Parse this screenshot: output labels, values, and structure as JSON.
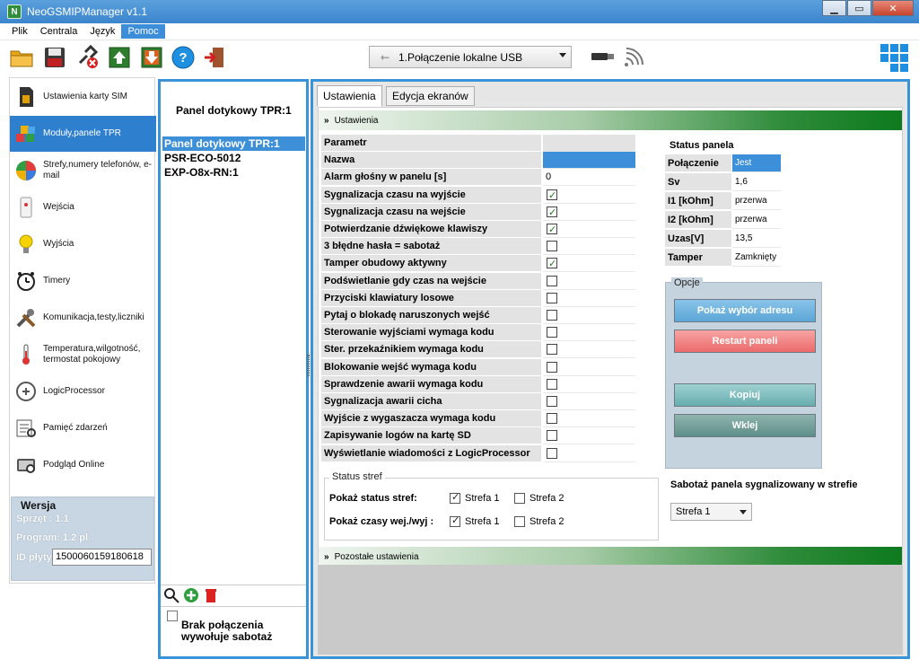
{
  "window": {
    "title": "NeoGSMIPManager v1.1",
    "icon_letter": "N",
    "minimize": "▁",
    "maximize": "▭",
    "close": "✕"
  },
  "menu": [
    "Plik",
    "Centrala",
    "Język",
    "Pomoc"
  ],
  "toolbar": {
    "icons": [
      "open-folder-icon",
      "save-disk-icon",
      "disconnect-icon",
      "upload-chip-icon",
      "download-chip-icon",
      "help-icon",
      "exit-icon"
    ],
    "connection": "1.Połączenie lokalne USB",
    "help_glyph": "?"
  },
  "nav": [
    {
      "label": "Ustawienia karty SIM",
      "icon": "sim-card-icon"
    },
    {
      "label": "Moduły,panele TPR",
      "icon": "modules-blocks-icon"
    },
    {
      "label": "Strefy,numery telefonów, e-mail",
      "icon": "zones-pie-icon"
    },
    {
      "label": "Wejścia",
      "icon": "inputs-sensor-icon"
    },
    {
      "label": "Wyjścia",
      "icon": "outputs-bulb-icon"
    },
    {
      "label": "Timery",
      "icon": "timer-clock-icon"
    },
    {
      "label": "Komunikacja,testy,liczniki",
      "icon": "tools-icon"
    },
    {
      "label": "Temperatura,wilgotność, termostat pokojowy",
      "icon": "thermometer-icon"
    },
    {
      "label": "LogicProcessor",
      "icon": "logic-processor-icon"
    },
    {
      "label": "Pamięć zdarzeń",
      "icon": "event-memory-icon"
    },
    {
      "label": "Podgląd Online",
      "icon": "online-preview-icon"
    }
  ],
  "version": {
    "title": "Wersja",
    "hw": "Sprzęt : 1.1",
    "program": "Program: 1.2 pl",
    "board_label": "ID płyty",
    "board_id": "1500060159180618"
  },
  "devices": {
    "title": "Panel dotykowy TPR:1",
    "items": [
      "Panel dotykowy TPR:1",
      "PSR-ECO-5012",
      "EXP-O8x-RN:1"
    ],
    "footer": "Brak połączenia wywołuje sabotaż"
  },
  "tabs": [
    "Ustawienia",
    "Edycja ekranów"
  ],
  "section1": "Ustawienia",
  "section2": "Pozostałe ustawienia",
  "params": {
    "header": "Parametr",
    "rows": [
      {
        "label": "Nazwa",
        "value": "",
        "type": "text"
      },
      {
        "label": "Alarm głośny w panelu [s]",
        "value": "0",
        "type": "text"
      },
      {
        "label": "Sygnalizacja czasu na wyjście",
        "checked": true,
        "type": "check"
      },
      {
        "label": "Sygnalizacja czasu na wejście",
        "checked": true,
        "type": "check"
      },
      {
        "label": "Potwierdzanie dźwiękowe klawiszy",
        "checked": true,
        "type": "check"
      },
      {
        "label": "3 błędne hasła = sabotaż",
        "checked": false,
        "type": "check"
      },
      {
        "label": "Tamper obudowy aktywny",
        "checked": true,
        "type": "check"
      },
      {
        "label": "Podświetlanie gdy czas na wejście",
        "checked": false,
        "type": "check"
      },
      {
        "label": "Przyciski klawiatury losowe",
        "checked": false,
        "type": "check"
      },
      {
        "label": "Pytaj o blokadę naruszonych wejść",
        "checked": false,
        "type": "check"
      },
      {
        "label": "Sterowanie wyjściami wymaga kodu",
        "checked": false,
        "type": "check"
      },
      {
        "label": "Ster. przekaźnikiem wymaga kodu",
        "checked": false,
        "type": "check"
      },
      {
        "label": "Blokowanie wejść wymaga kodu",
        "checked": false,
        "type": "check"
      },
      {
        "label": "Sprawdzenie awarii wymaga kodu",
        "checked": false,
        "type": "check"
      },
      {
        "label": "Sygnalizacja awarii cicha",
        "checked": false,
        "type": "check"
      },
      {
        "label": "Wyjście z wygaszacza wymaga kodu",
        "checked": false,
        "type": "check"
      },
      {
        "label": "Zapisywanie  logów na  kartę SD",
        "checked": false,
        "type": "check"
      },
      {
        "label": "Wyświetlanie wiadomości z LogicProcessor",
        "checked": false,
        "type": "check"
      }
    ]
  },
  "status_panel": {
    "title": "Status panela",
    "rows": [
      {
        "label": "Połączenie",
        "value": "Jest"
      },
      {
        "label": "Sv",
        "value": "1,6"
      },
      {
        "label": "I1 [kOhm]",
        "value": "przerwa"
      },
      {
        "label": "I2 [kOhm]",
        "value": "przerwa"
      },
      {
        "label": "Uzas[V]",
        "value": "13,5"
      },
      {
        "label": "Tamper",
        "value": "Zamknięty"
      }
    ]
  },
  "options": {
    "title": "Opcje",
    "show_address": "Pokaż wybór adresu",
    "restart": "Restart  paneli",
    "copy": "Kopiuj",
    "paste": "Wklej"
  },
  "sabotage": {
    "label": "Sabotaż panela sygnalizowany w strefie",
    "value": "Strefa 1"
  },
  "zones_status": {
    "title": "Status stref",
    "row1_label": "Pokaż status stref:",
    "row2_label": "Pokaż czasy wej./wyj :",
    "zone1": "Strefa 1",
    "zone2": "Strefa 2"
  }
}
